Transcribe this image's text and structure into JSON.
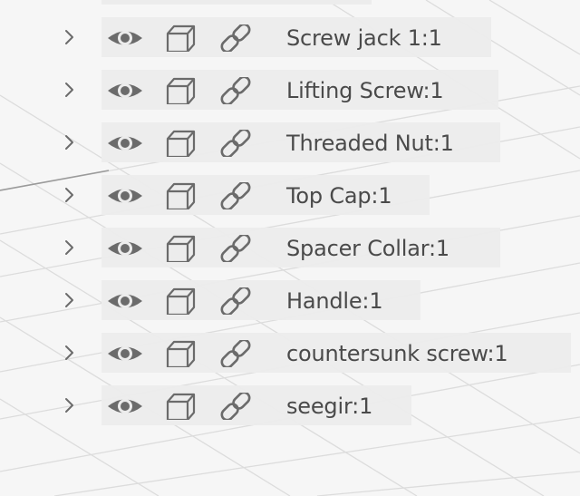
{
  "browser": {
    "items": [
      {
        "label": "Screw jack 1:1"
      },
      {
        "label": "Lifting Screw:1"
      },
      {
        "label": "Threaded Nut:1"
      },
      {
        "label": "Top Cap:1"
      },
      {
        "label": "Spacer Collar:1"
      },
      {
        "label": "Handle:1"
      },
      {
        "label": "countersunk screw:1"
      },
      {
        "label": "seegir:1"
      }
    ]
  },
  "colors": {
    "icon": "#6b6b6b",
    "text": "#4a4a4a",
    "row_background": "#ececec",
    "canvas": "#f6f6f6",
    "grid": "#dedede"
  },
  "icons": [
    "chevron-right-icon",
    "eye-icon",
    "body-cube-icon",
    "link-icon"
  ]
}
